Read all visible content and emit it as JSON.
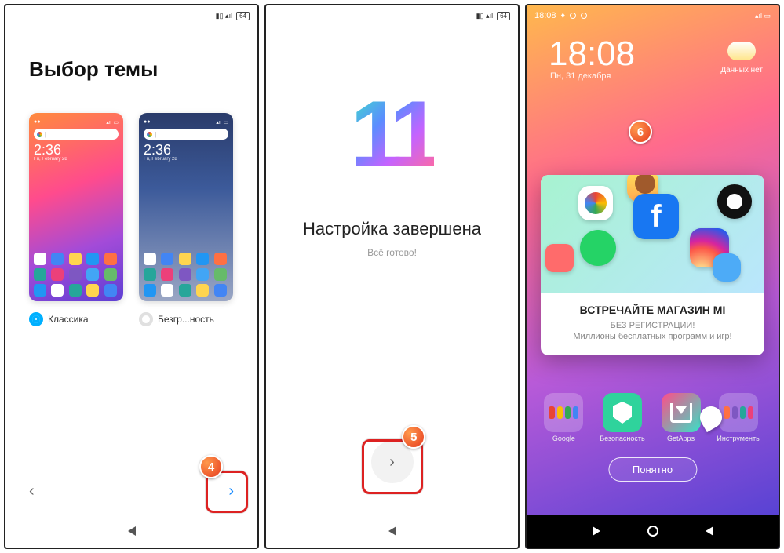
{
  "badges": {
    "b4": "4",
    "b5": "5",
    "b6": "6"
  },
  "status": {
    "battery": "64"
  },
  "screen1": {
    "title": "Выбор темы",
    "themes": {
      "classic": {
        "label": "Классика",
        "time": "2:36",
        "selected": true
      },
      "limitless": {
        "label": "Безгр...ность",
        "time": "2:36",
        "selected": false
      }
    }
  },
  "screen2": {
    "logo": "11",
    "title": "Настройка завершена",
    "subtitle": "Всё готово!"
  },
  "screen3": {
    "status_time": "18:08",
    "clock": "18:08",
    "date": "Пн, 31 декабря",
    "weather_label": "Данных нет",
    "popup": {
      "title": "ВСТРЕЧАЙТЕ МАГАЗИН MI",
      "line1": "БЕЗ РЕГИСТРАЦИИ!",
      "line2": "Миллионы бесплатных программ и игр!"
    },
    "dock": {
      "google": "Google",
      "security": "Безопасность",
      "getapps": "GetApps",
      "tools": "Инструменты"
    },
    "button": "Понятно"
  }
}
